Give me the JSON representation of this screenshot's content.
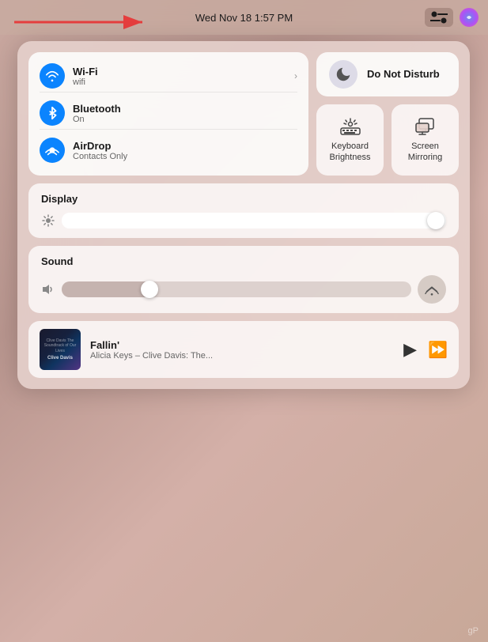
{
  "menubar": {
    "datetime": "Wed Nov 18  1:57 PM",
    "control_center_label": "Control Center",
    "siri_label": "Siri"
  },
  "network_tile": {
    "wifi": {
      "name": "Wi-Fi",
      "sub": "wifi",
      "icon": "wifi"
    },
    "bluetooth": {
      "name": "Bluetooth",
      "sub": "On",
      "icon": "bluetooth"
    },
    "airdrop": {
      "name": "AirDrop",
      "sub": "Contacts Only",
      "icon": "airdrop"
    }
  },
  "dnd_tile": {
    "label": "Do Not\nDisturb"
  },
  "keyboard_brightness_tile": {
    "label": "Keyboard\nBrightness"
  },
  "screen_mirroring_tile": {
    "label": "Screen\nMirroring"
  },
  "display_section": {
    "title": "Display",
    "slider_value": 95
  },
  "sound_section": {
    "title": "Sound",
    "slider_value": 25,
    "airplay_label": "AirPlay"
  },
  "now_playing": {
    "title": "Fallin'",
    "artist": "Alicia Keys – Clive Davis: The...",
    "album_label": "Clive Davis\nThe Soundtrack\nof Our Lives"
  },
  "watermark": {
    "text": "gP"
  }
}
